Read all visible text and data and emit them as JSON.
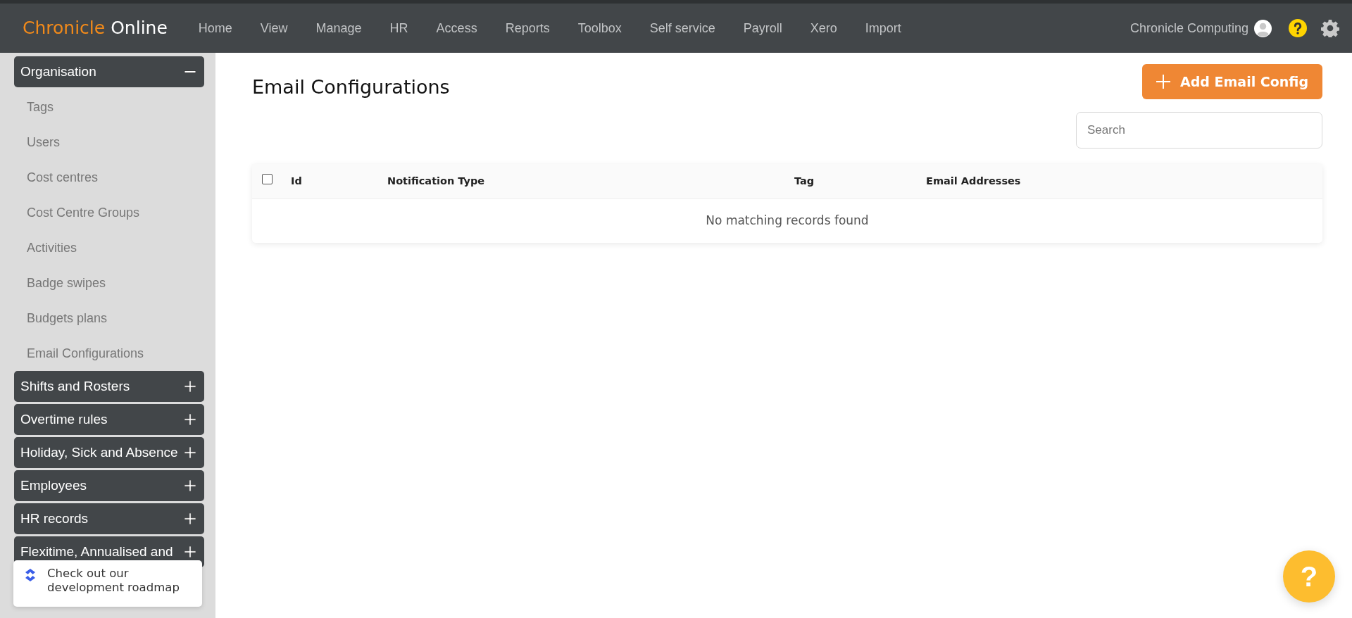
{
  "brand": {
    "accent": "Chronicle",
    "rest": "Online"
  },
  "nav": [
    "Home",
    "View",
    "Manage",
    "HR",
    "Access",
    "Reports",
    "Toolbox",
    "Self service",
    "Payroll",
    "Xero",
    "Import"
  ],
  "user": {
    "name": "Chronicle Computing"
  },
  "sidebar": {
    "sections": [
      {
        "label": "Organisation",
        "expanded": true,
        "items": [
          "Tags",
          "Users",
          "Cost centres",
          "Cost Centre Groups",
          "Activities",
          "Badge swipes",
          "Budgets plans",
          "Email Configurations"
        ]
      },
      {
        "label": "Shifts and Rosters",
        "expanded": false
      },
      {
        "label": "Overtime rules",
        "expanded": false
      },
      {
        "label": "Holiday, Sick and Absence",
        "expanded": false
      },
      {
        "label": "Employees",
        "expanded": false
      },
      {
        "label": "HR records",
        "expanded": false
      },
      {
        "label": "Flexitime, Annualised and",
        "expanded": false
      }
    ]
  },
  "roadmap": {
    "text": "Check out our development roadmap"
  },
  "page": {
    "title": "Email Configurations",
    "add_button": "Add Email Config",
    "search": {
      "placeholder": "Search"
    }
  },
  "table": {
    "select_all": {
      "checked": false
    },
    "columns": [
      "Id",
      "Notification Type",
      "Tag",
      "Email Addresses"
    ],
    "empty": "No matching records found"
  },
  "help_button": "?"
}
